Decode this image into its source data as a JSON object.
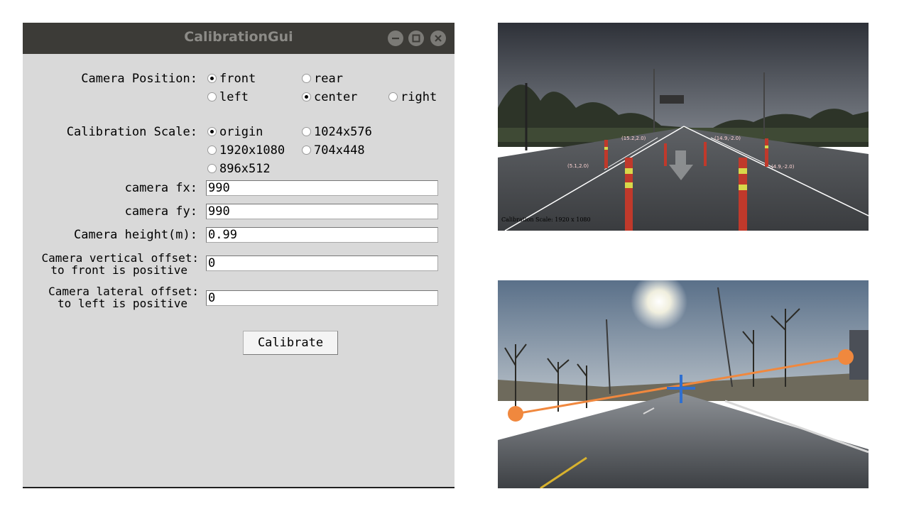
{
  "window": {
    "title": "CalibrationGui",
    "camera_position": {
      "label": "Camera Position:",
      "options": [
        "front",
        "rear",
        "left",
        "center",
        "right"
      ],
      "selected": [
        "front",
        "center"
      ]
    },
    "calibration_scale": {
      "label": "Calibration Scale:",
      "options": [
        "origin",
        "1024x576",
        "1920x1080",
        "704x448",
        "896x512"
      ],
      "selected": "origin"
    },
    "fields": {
      "fx": {
        "label": "camera fx:",
        "value": "990"
      },
      "fy": {
        "label": "camera fy:",
        "value": "990"
      },
      "height": {
        "label": "Camera height(m):",
        "value": "0.99"
      },
      "vertical": {
        "label_line1": "Camera vertical offset:",
        "label_line2": "to front is positive",
        "value": "0"
      },
      "lateral": {
        "label_line1": "Camera lateral offset:",
        "label_line2": "to left is positive",
        "value": "0"
      }
    },
    "calibrate_label": "Calibrate"
  },
  "top_image": {
    "scale_text": "Calibration Scale: 1920 x 1080",
    "points": [
      "(15.2,2.0)",
      "(14.9,-2.0)",
      "(5.1,2.0)",
      "(4.9,-2.0)"
    ]
  },
  "colors": {
    "titlebar": "#3c3b37",
    "window_bg": "#d9d9d9",
    "marker_orange": "#f0883e",
    "cross_blue": "#2f6fd0"
  },
  "icons": {
    "minimize": "minimize-icon",
    "maximize": "maximize-icon",
    "close": "close-icon"
  }
}
